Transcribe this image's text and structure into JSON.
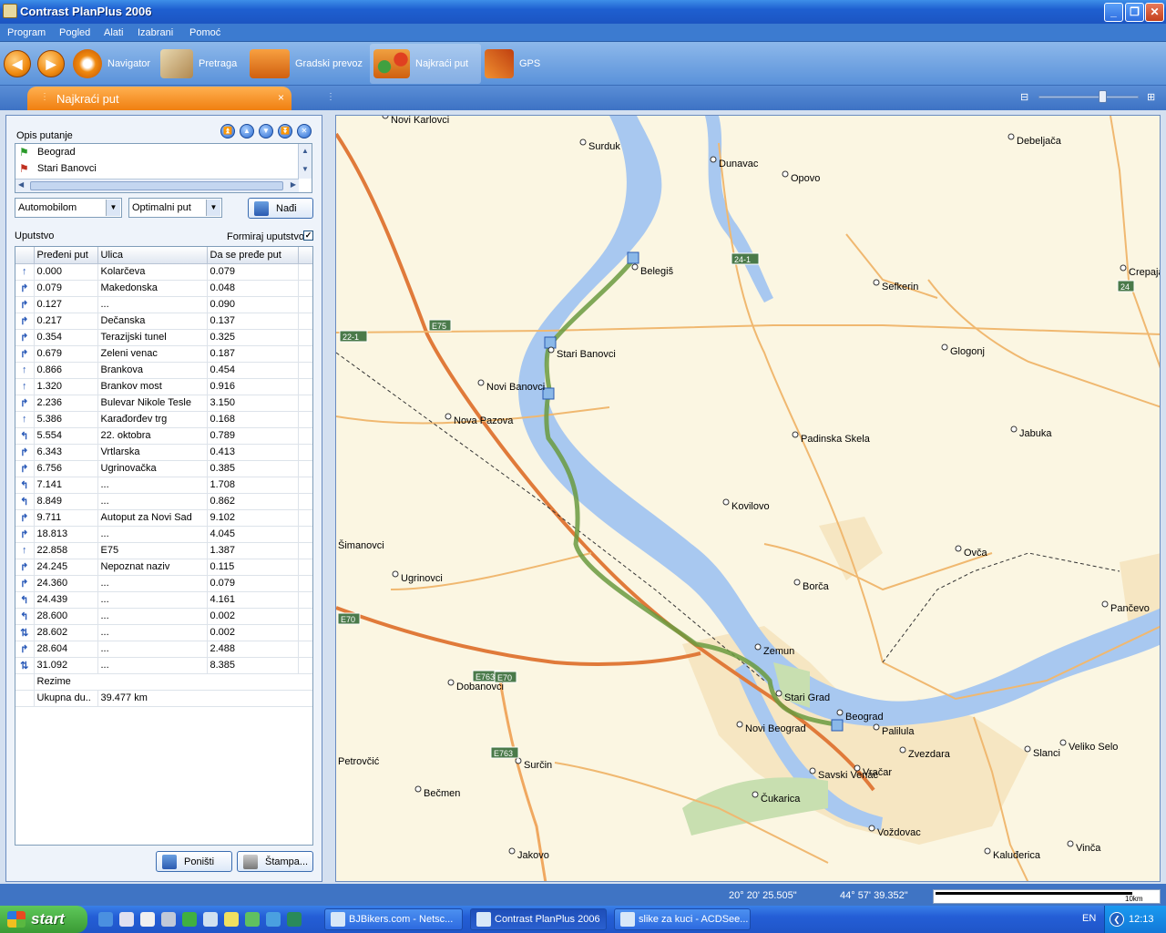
{
  "window": {
    "title": "Contrast PlanPlus 2006"
  },
  "menu": [
    "Program",
    "Pogled",
    "Alati",
    "Izabrani",
    "Pomoć"
  ],
  "toolbar": {
    "tools": [
      {
        "label": "Navigator",
        "icon": "navigator-icon"
      },
      {
        "label": "Pretraga",
        "icon": "search-icon"
      },
      {
        "label": "Gradski prevoz",
        "icon": "bus-icon"
      },
      {
        "label": "Najkraći put",
        "icon": "route-icon"
      },
      {
        "label": "GPS",
        "icon": "satellite-icon"
      }
    ]
  },
  "tab": {
    "label": "Najkraći put",
    "close": "×"
  },
  "panel": {
    "route_description_label": "Opis putanje",
    "waypoints": [
      "Beograd",
      "Stari Banovci"
    ],
    "vehicle_select": "Automobilom",
    "route_type_select": "Optimalni put",
    "find_button": "Nađi",
    "instructions_label": "Uputstvo",
    "form_instructions_label": "Formiraj uputstvo",
    "columns": [
      "Pređeni put",
      "Ulica",
      "Da se pređe put"
    ],
    "rows": [
      {
        "dir": "↑",
        "dist": "0.000",
        "street": "Kolarčeva",
        "len": "0.079"
      },
      {
        "dir": "↱",
        "dist": "0.079",
        "street": "Makedonska",
        "len": "0.048"
      },
      {
        "dir": "↱",
        "dist": "0.127",
        "street": "...",
        "len": "0.090"
      },
      {
        "dir": "↱",
        "dist": "0.217",
        "street": "Dečanska",
        "len": "0.137"
      },
      {
        "dir": "↱",
        "dist": "0.354",
        "street": "Terazijski tunel",
        "len": "0.325"
      },
      {
        "dir": "↱",
        "dist": "0.679",
        "street": "Zeleni venac",
        "len": "0.187"
      },
      {
        "dir": "↑",
        "dist": "0.866",
        "street": "Brankova",
        "len": "0.454"
      },
      {
        "dir": "↑",
        "dist": "1.320",
        "street": "Brankov most",
        "len": "0.916"
      },
      {
        "dir": "↱",
        "dist": "2.236",
        "street": "Bulevar Nikole Tesle",
        "len": "3.150"
      },
      {
        "dir": "↑",
        "dist": "5.386",
        "street": "Karađorđev trg",
        "len": "0.168"
      },
      {
        "dir": "↰",
        "dist": "5.554",
        "street": "22. oktobra",
        "len": "0.789"
      },
      {
        "dir": "↱",
        "dist": "6.343",
        "street": "Vrtlarska",
        "len": "0.413"
      },
      {
        "dir": "↱",
        "dist": "6.756",
        "street": "Ugrinovačka",
        "len": "0.385"
      },
      {
        "dir": "↰",
        "dist": "7.141",
        "street": "...",
        "len": "1.708"
      },
      {
        "dir": "↰",
        "dist": "8.849",
        "street": "...",
        "len": "0.862"
      },
      {
        "dir": "↱",
        "dist": "9.711",
        "street": "Autoput za Novi Sad",
        "len": "9.102"
      },
      {
        "dir": "↱",
        "dist": "18.813",
        "street": "...",
        "len": "4.045"
      },
      {
        "dir": "↑",
        "dist": "22.858",
        "street": "E75",
        "len": "1.387"
      },
      {
        "dir": "↱",
        "dist": "24.245",
        "street": "Nepoznat naziv",
        "len": "0.115"
      },
      {
        "dir": "↱",
        "dist": "24.360",
        "street": "...",
        "len": "0.079"
      },
      {
        "dir": "↰",
        "dist": "24.439",
        "street": "...",
        "len": "4.161"
      },
      {
        "dir": "↰",
        "dist": "28.600",
        "street": "...",
        "len": "0.002"
      },
      {
        "dir": "⇅",
        "dist": "28.602",
        "street": "...",
        "len": "0.002"
      },
      {
        "dir": "↱",
        "dist": "28.604",
        "street": "...",
        "len": "2.488"
      },
      {
        "dir": "⇅",
        "dist": "31.092",
        "street": "...",
        "len": "8.385"
      }
    ],
    "summary_label": "Rezime",
    "total_label": "Ukupna du..",
    "total_value": "39.477 km",
    "cancel_button": "Poništi",
    "print_button": "Štampa..."
  },
  "map": {
    "places": [
      {
        "name": "Novi Karlovci"
      },
      {
        "name": "Surduk"
      },
      {
        "name": "Dunavac"
      },
      {
        "name": "Opovo"
      },
      {
        "name": "Debeljača"
      },
      {
        "name": "Belegiš"
      },
      {
        "name": "Crepaja"
      },
      {
        "name": "Sefkerin"
      },
      {
        "name": "Stari Banovci"
      },
      {
        "name": "Glogonj"
      },
      {
        "name": "Novi Banovci"
      },
      {
        "name": "Nova Pazova"
      },
      {
        "name": "Padinska Skela"
      },
      {
        "name": "Jabuka"
      },
      {
        "name": "Kovilovo"
      },
      {
        "name": "Ovča"
      },
      {
        "name": "Borča"
      },
      {
        "name": "Pančevo"
      },
      {
        "name": "Ugrinovci"
      },
      {
        "name": "Zemun"
      },
      {
        "name": "Stari Grad"
      },
      {
        "name": "Beograd"
      },
      {
        "name": "Palilula"
      },
      {
        "name": "Novi Beograd"
      },
      {
        "name": "Zvezdara"
      },
      {
        "name": "Veliko Selo"
      },
      {
        "name": "Slanci"
      },
      {
        "name": "Dobanovci"
      },
      {
        "name": "Vračar"
      },
      {
        "name": "Savski Venac"
      },
      {
        "name": "Surčin"
      },
      {
        "name": "Čukarica"
      },
      {
        "name": "Bečmen"
      },
      {
        "name": "Voždovac"
      },
      {
        "name": "Kaluđerica"
      },
      {
        "name": "Vinča"
      },
      {
        "name": "Jakovo"
      },
      {
        "name": "Petrovčić"
      },
      {
        "name": "Šimanovci"
      }
    ],
    "road_shields": [
      "E75",
      "22-1",
      "24-1",
      "24",
      "E70",
      "E763",
      "E70",
      "E763"
    ]
  },
  "status": {
    "longitude": "20° 20' 25.505\"",
    "latitude": "44° 57' 39.352\"",
    "scale_label": "10km"
  },
  "taskbar": {
    "start": "start",
    "tasks": [
      "BJBikers.com - Netsc...",
      "Contrast PlanPlus 2006",
      "slike za kuci - ACDSee..."
    ],
    "lang": "EN",
    "clock": "12:13"
  }
}
